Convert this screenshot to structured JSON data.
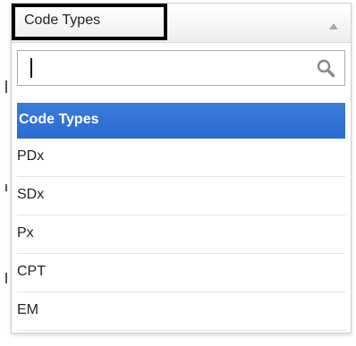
{
  "select": {
    "selected_label": "Code Types"
  },
  "search": {
    "value": "",
    "placeholder": ""
  },
  "options": [
    {
      "label": "Code Types",
      "highlighted": true
    },
    {
      "label": "PDx"
    },
    {
      "label": "SDx"
    },
    {
      "label": "Px"
    },
    {
      "label": "CPT"
    },
    {
      "label": "EM"
    }
  ],
  "colors": {
    "highlight": "#2f74d8",
    "focus_border": "#000000"
  }
}
